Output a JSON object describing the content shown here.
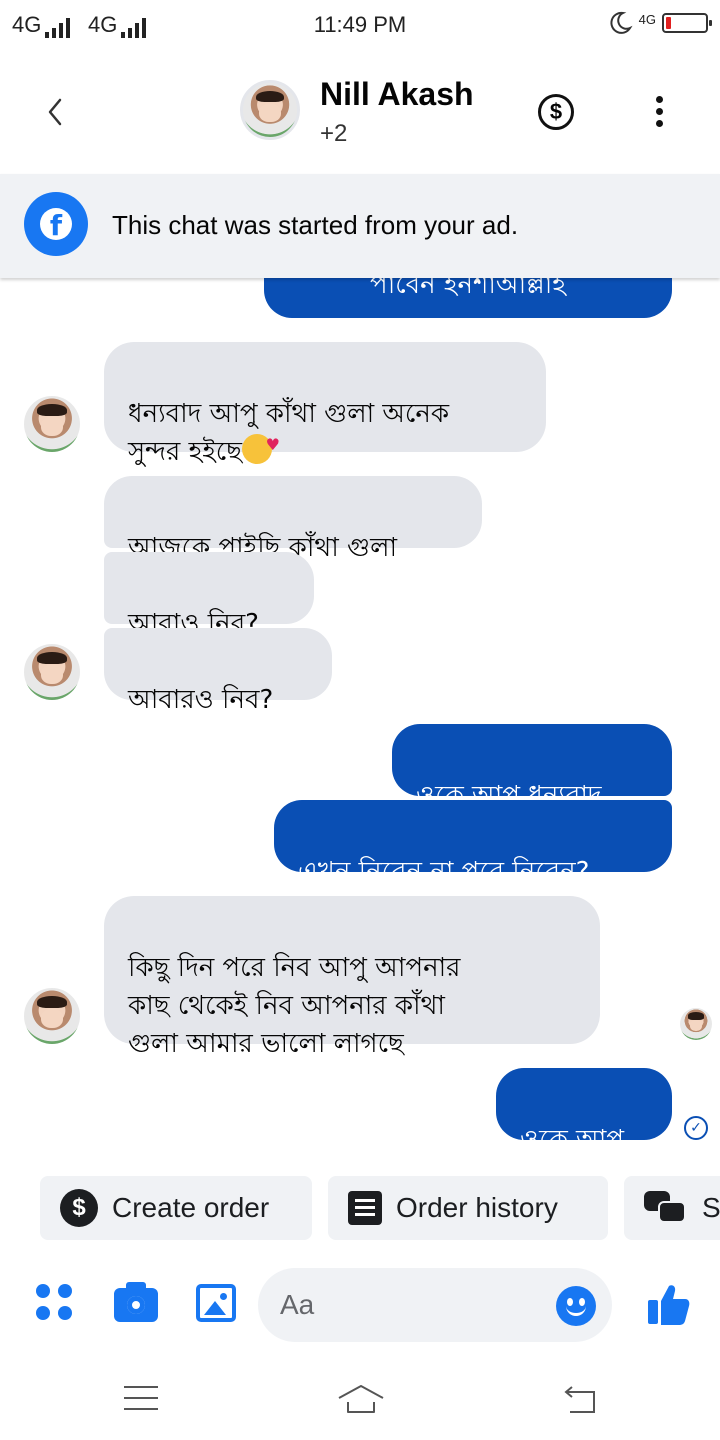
{
  "status_bar": {
    "network_1": "4G",
    "network_2": "4G",
    "time": "11:49 PM",
    "battery_network": "4G"
  },
  "header": {
    "contact_name": "Nill Akash",
    "contact_sub": "+2",
    "icons": [
      "back-icon",
      "avatar",
      "dollar-icon",
      "more-icon"
    ]
  },
  "ad_banner": {
    "text": "This chat was started from your ad."
  },
  "messages": [
    {
      "direction": "out",
      "text": "পাবেন ইনশাআল্লাহ",
      "partial": true
    },
    {
      "direction": "in",
      "text": "ধন্যবাদ আপু কাঁথা গুলা অনেক\nসুন্দর হইছে",
      "emoji": "smiling-face-with-hearts"
    },
    {
      "direction": "in",
      "text": "আজকে পাইছি কাঁথা গুলা"
    },
    {
      "direction": "in",
      "text": "আবাও নিব?"
    },
    {
      "direction": "in",
      "text": "আবারও নিব?"
    },
    {
      "direction": "out",
      "text": "ওকে আপু ধন্যবাদ"
    },
    {
      "direction": "out",
      "text": "এখন নিবেন না পরে নিবেন?"
    },
    {
      "direction": "in",
      "text": "কিছু দিন পরে নিব আপু  আপনার\nকাছ থেকেই নিব আপনার কাঁথা\nগুলা আমার ভালো লাগছে"
    },
    {
      "direction": "out",
      "text": "ওকে আপু",
      "status": "sent"
    }
  ],
  "quick_replies": [
    {
      "label": "Create order",
      "icon": "dollar-icon"
    },
    {
      "label": "Order history",
      "icon": "list-icon"
    },
    {
      "label": "Sa",
      "icon": "chat-bubbles-icon"
    }
  ],
  "composer": {
    "placeholder": "Aa",
    "value": "",
    "icons": [
      "apps-icon",
      "camera-icon",
      "image-icon",
      "emoji-icon",
      "like-icon"
    ]
  },
  "nav_bar": {
    "icons": [
      "menu-icon",
      "home-icon",
      "back-icon"
    ]
  },
  "colors": {
    "outgoing_bubble": "#0a4fb4",
    "incoming_bubble": "#e4e6eb",
    "accent": "#1877f2",
    "banner_bg": "#f0f2f5"
  }
}
